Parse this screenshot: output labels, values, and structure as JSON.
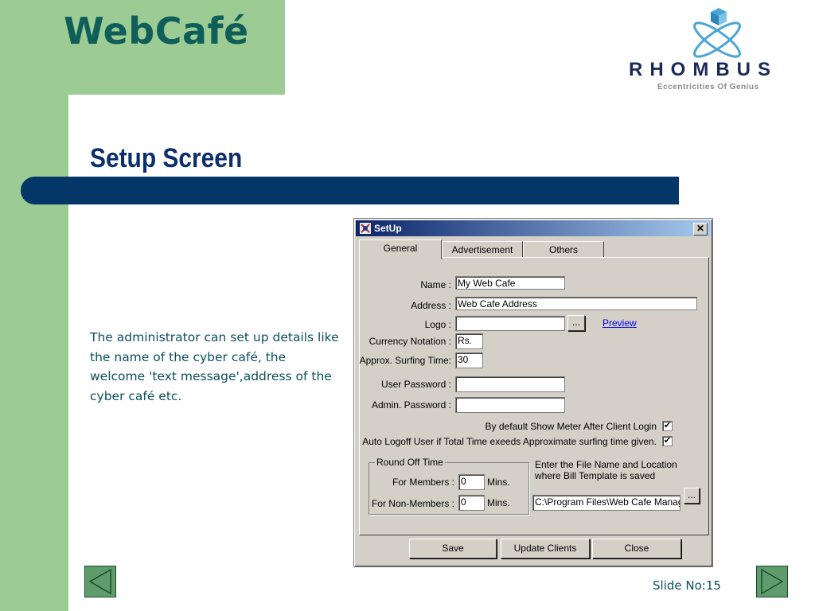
{
  "brand": {
    "title": "WebCafé"
  },
  "logo": {
    "name": "RHOMBUS",
    "tagline": "Eccentricities Of Genius"
  },
  "slide": {
    "title": "Setup Screen",
    "body": "The administrator can set up details like the name of the cyber café, the welcome 'text message',address of the cyber café etc.",
    "slide_no": "Slide No:15"
  },
  "dialog": {
    "title": "SetUp",
    "close_glyph": "✕",
    "tabs": [
      {
        "label": "General",
        "active": true
      },
      {
        "label": "Advertisement",
        "active": false
      },
      {
        "label": "Others",
        "active": false
      }
    ],
    "fields": {
      "name_label": "Name :",
      "name_value": "My Web Cafe",
      "address_label": "Address :",
      "address_value": "Web Cafe Address",
      "logo_label": "Logo :",
      "logo_value": "",
      "browse_label": "...",
      "preview_label": "Preview",
      "currency_label": "Currency Notation :",
      "currency_value": "Rs.",
      "surfing_label": "Approx. Surfing Time:",
      "surfing_value": "30",
      "user_password_label": "User Password :",
      "user_password_value": "",
      "admin_password_label": "Admin. Password :",
      "admin_password_value": ""
    },
    "checks": {
      "show_meter_label": "By default Show Meter After Client Login",
      "show_meter_checked": true,
      "auto_logoff_label": "Auto Logoff User if Total Time exeeds Approximate surfing time given.",
      "auto_logoff_checked": true,
      "check_glyph": "✔"
    },
    "round_off": {
      "legend": "Round Off Time",
      "members_label": "For Members :",
      "members_value": "0",
      "non_members_label": "For Non-Members :",
      "non_members_value": "0",
      "unit": "Mins."
    },
    "bill_template": {
      "label": "Enter the File Name and Location where Bill Template is saved",
      "path": "C:\\Program Files\\Web Cafe Manag",
      "browse_label": "..."
    },
    "buttons": {
      "save": "Save",
      "update_clients": "Update Clients",
      "close": "Close"
    }
  },
  "colors": {
    "sidebar": "#9ccc94",
    "title_bar": "#043768",
    "title_text": "#0b2f6b",
    "brand_text": "#0f5e5a",
    "body_text": "#0b4f5e",
    "dialog_face": "#d4d0c8",
    "link": "#0000ee"
  },
  "icons": [
    "prev-slide-icon",
    "next-slide-icon",
    "rhombus-logo-icon",
    "setup-app-icon",
    "close-icon",
    "checkmark-icon"
  ]
}
